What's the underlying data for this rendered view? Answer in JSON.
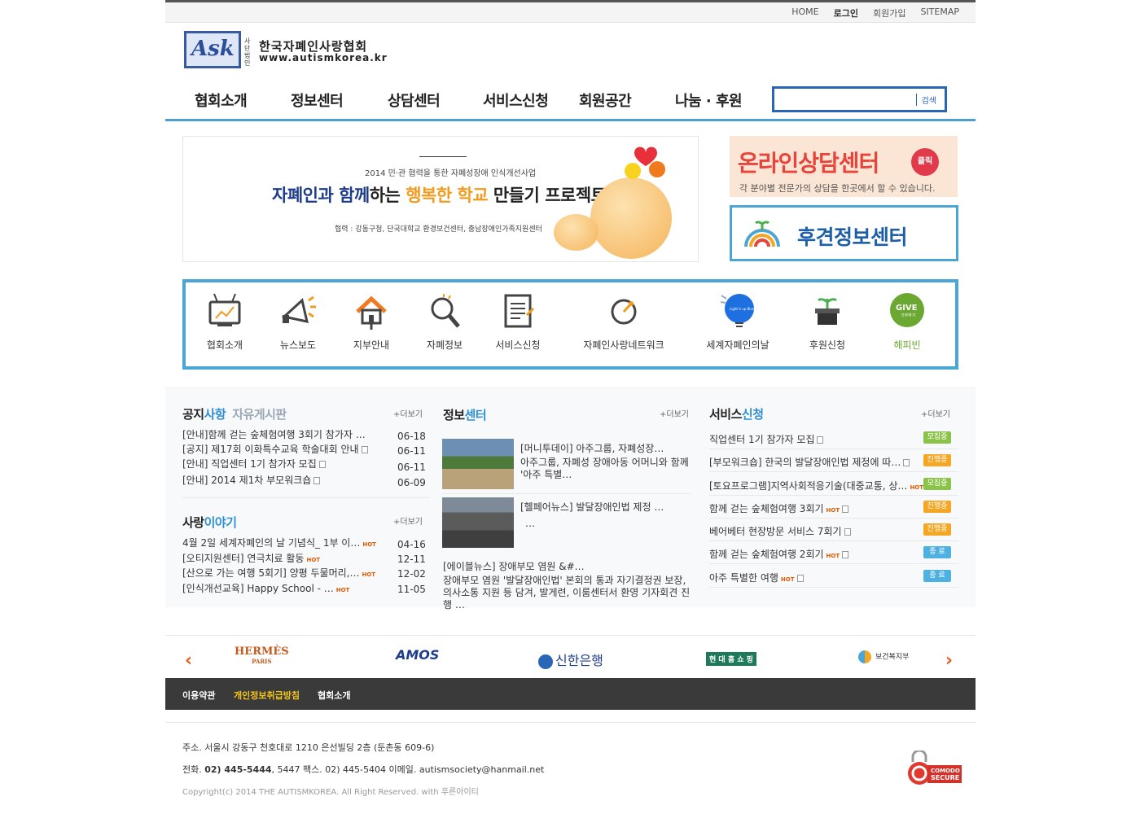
{
  "util_nav": [
    "HOME",
    "로그인",
    "회원가입",
    "SITEMAP"
  ],
  "logo": {
    "mark": "Ask",
    "small": "사단 법인",
    "name": "한국자폐인사랑협회",
    "url": "www.autismkorea.kr"
  },
  "gnb": [
    "협회소개",
    "정보센터",
    "상담센터",
    "서비스신청",
    "회원공간",
    "나눔 · 후원"
  ],
  "search": {
    "button": "검색",
    "placeholder": ""
  },
  "banner": {
    "prev": "‹",
    "next": "›",
    "sub": "2014 민·관 협력을 통한 자폐성장애 인식개선사업",
    "main_a": "자폐인과 함께",
    "main_b": "하는 ",
    "main_c": "행복한 학교",
    "main_d": " 만들기 프로젝트",
    "coop": "협력 : 강동구청, 단국대학교 환경보건센터, 충남장애인가족지원센터"
  },
  "online_banner": {
    "title": "온라인상담센터",
    "click": "클릭",
    "desc": "각 분야별 전문가의 상담을 한곳에서 할 수 있습니다."
  },
  "guardian_banner": {
    "title": "후견정보센터"
  },
  "quick_menu": [
    {
      "label": "협회소개",
      "icon": "tv-icon"
    },
    {
      "label": "뉴스보도",
      "icon": "megaphone-icon"
    },
    {
      "label": "지부안내",
      "icon": "house-icon"
    },
    {
      "label": "자폐정보",
      "icon": "magnifier-icon"
    },
    {
      "label": "서비스신청",
      "icon": "document-icon"
    },
    {
      "label": "자폐인사랑네트워크",
      "icon": "network-icon"
    },
    {
      "label": "세계자폐인의날",
      "icon": "lightbulb-icon",
      "bulb_text": "Light it up Blue!"
    },
    {
      "label": "후원신청",
      "icon": "plant-icon"
    },
    {
      "label": "해피빈",
      "icon": "give-icon",
      "give": "GIVE",
      "give_sub": "기부하기"
    }
  ],
  "notice": {
    "tab1_a": "공지",
    "tab1_b": "사항",
    "tab2": "자유게시판",
    "more": "+더보기",
    "items": [
      {
        "title": "[안내]함께 걷는 숲체험여행 3회기 참가자 …",
        "date": "06-18"
      },
      {
        "title": "[공지] 제17회 이화특수교육 학술대회 안내",
        "date": "06-11"
      },
      {
        "title": "[안내] 직업센터 1기 참가자 모집",
        "date": "06-11"
      },
      {
        "title": "[안내] 2014 제1차 부모워크숍",
        "date": "06-09"
      }
    ]
  },
  "story": {
    "tab_a": "사랑",
    "tab_b": "이야기",
    "more": "+더보기",
    "hot": "HOT",
    "items": [
      {
        "title": "4월 2일 세계자폐인의 날 기념식_ 1부 이…",
        "date": "04-16"
      },
      {
        "title": "[오티지원센터] 연극치료 활동",
        "date": "12-11"
      },
      {
        "title": "[산으로 가는 여행 5회기] 양평 두물머리,…",
        "date": "12-02"
      },
      {
        "title": "[인식개선교육] Happy School - …",
        "date": "11-05"
      }
    ]
  },
  "info": {
    "tab_a": "정보",
    "tab_b": "센터",
    "more": "+더보기",
    "items": [
      {
        "title": "[머니투데이] 아주그룹, 자폐성장…",
        "body": "아주그룹, 자폐성 장애아동 어머니와 함께 '아주 특별…"
      },
      {
        "title": "[헬페어뉴스] 발달장애인법 제정 …",
        "body": "…"
      },
      {
        "title": "[에이블뉴스] 장애부모 염원 &#…",
        "body": "장애부모 염원 '발달장애인법' 본회의 통과 자기결정권 보장, 의사소통 지원 등 담겨, 발게련, 이룸센터서 환영 기자회견 진행 …"
      }
    ]
  },
  "service": {
    "tab_a": "서비스",
    "tab_b": "신청",
    "more": "+더보기",
    "items": [
      {
        "title": "직업센터 1기 참가자 모집",
        "hot": false,
        "status": "모집중",
        "color": "#8bc34a"
      },
      {
        "title": "[부모워크숍] 한국의 발달장애인법 제정에 따…",
        "hot": false,
        "status": "진행중",
        "color": "#f5a623"
      },
      {
        "title": "[토요프로그램]지역사회적응기술(대중교통, 상…",
        "hot": true,
        "status": "모집중",
        "color": "#8bc34a"
      },
      {
        "title": "함께 걷는 숲체험여행 3회기",
        "hot": true,
        "status": "진행중",
        "color": "#f5a623"
      },
      {
        "title": "베어베터 현장방문 서비스 7회기",
        "hot": false,
        "status": "진행중",
        "color": "#f5a623"
      },
      {
        "title": "함께 걷는 숲체험여행 2회기",
        "hot": true,
        "status": "종 료",
        "color": "#4fb0e2"
      },
      {
        "title": "아주 특별한 여행",
        "hot": true,
        "status": "종 료",
        "color": "#4fb0e2"
      }
    ]
  },
  "sponsors": {
    "hermes": "HERMÈS",
    "hermes_sub": "PARIS",
    "amos": "AMOS",
    "shinhan": "신한은행",
    "hyundai": "현 대 홈 쇼 핑",
    "mohw": "보건복지부",
    "prev": "‹",
    "next": "›"
  },
  "footer": {
    "links": [
      "이용약관",
      "개인정보취급방침",
      "협회소개"
    ],
    "address": "주소. 서울시 강동구 천호대로 1210 은선빌딩 2층 (둔촌동 609-6)",
    "tel_label": "전화. ",
    "tel_bold": "02) 445-5444",
    "tel_rest": ", 5447   팩스. 02) 445-5404   이메일. autismsociety@hanmail.net",
    "copyright": "Copyright(c) 2014 THE AUTISMKOREA. All Right Reserved. with 푸른아이티",
    "secure_a": "COMODO",
    "secure_b": "SECURE"
  },
  "colors": {
    "accent": "#4ba6d6",
    "brand_blue": "#2a66b8",
    "orange": "#f39b1e",
    "red": "#e8443c"
  }
}
